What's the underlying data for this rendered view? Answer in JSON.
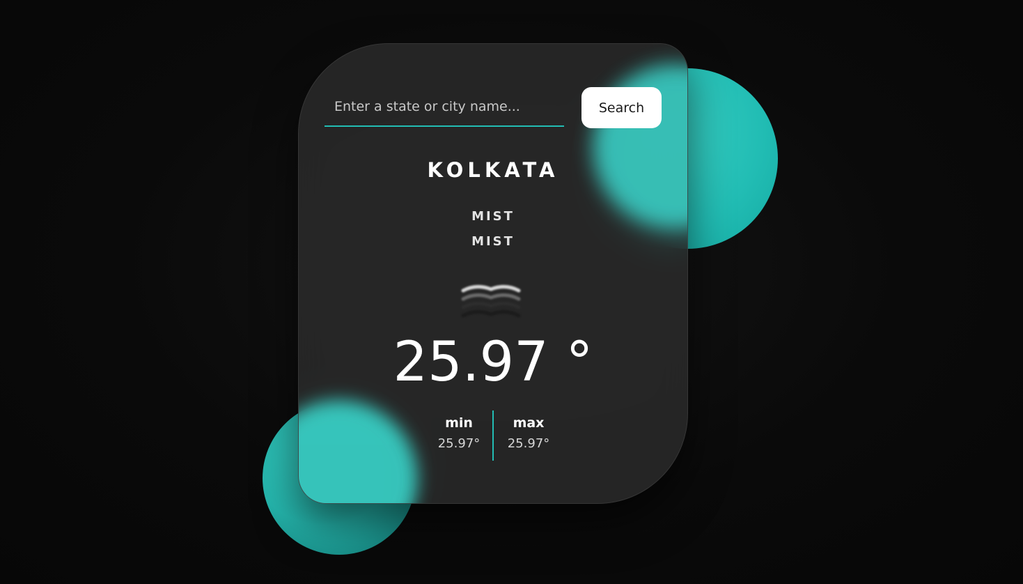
{
  "search": {
    "placeholder": "Enter a state or city name...",
    "value": "",
    "button_label": "Search"
  },
  "weather": {
    "city": "KOLKATA",
    "condition_main": "MIST",
    "condition_desc": "MIST",
    "icon": "mist-icon",
    "temperature": "25.97 °",
    "min_label": "min",
    "min_value": "25.97°",
    "max_label": "max",
    "max_value": "25.97°"
  },
  "colors": {
    "accent": "#22bdb4",
    "background": "#0b0b0b",
    "card": "#2a2a2a",
    "button_bg": "#ffffff"
  }
}
